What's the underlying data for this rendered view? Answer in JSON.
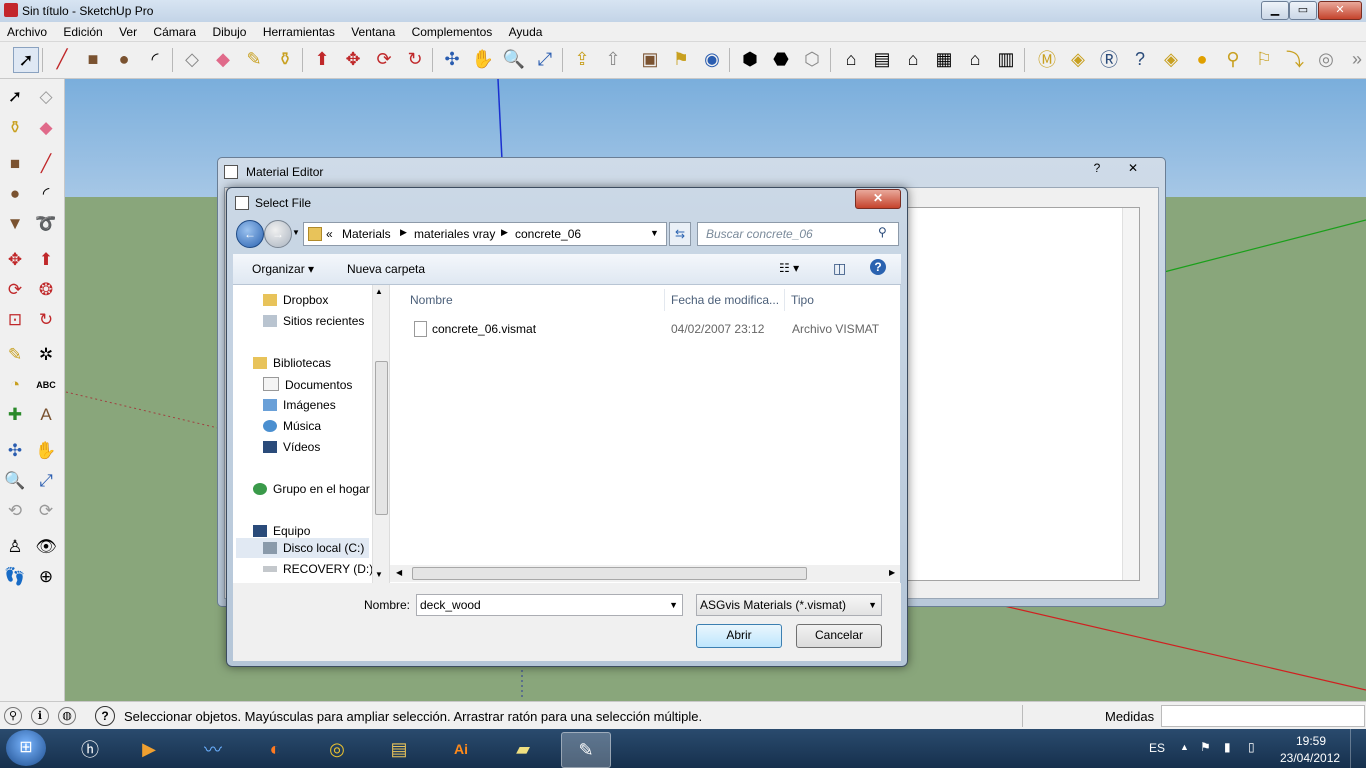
{
  "app": {
    "title": "Sin título - SketchUp Pro"
  },
  "menu": [
    "Archivo",
    "Edición",
    "Ver",
    "Cámara",
    "Dibujo",
    "Herramientas",
    "Ventana",
    "Complementos",
    "Ayuda"
  ],
  "material_editor": {
    "title": "Material Editor",
    "help": "?",
    "close": "✕"
  },
  "select_file": {
    "title": "Select File",
    "close": "✕",
    "breadcrumb": {
      "prefix": "«",
      "parts": [
        "Materials",
        "materiales vray",
        "concrete_06"
      ]
    },
    "search_placeholder": "Buscar concrete_06",
    "commands": {
      "organize": "Organizar",
      "new_folder": "Nueva carpeta"
    },
    "nav": {
      "favorites": [
        "Dropbox",
        "Sitios recientes"
      ],
      "libraries": "Bibliotecas",
      "library_items": [
        "Documentos",
        "Imágenes",
        "Música",
        "Vídeos"
      ],
      "homegroup": "Grupo en el hogar",
      "computer": "Equipo",
      "drives": [
        "Disco local (C:)",
        "RECOVERY (D:)"
      ]
    },
    "columns": {
      "name": "Nombre",
      "date": "Fecha de modifica...",
      "type": "Tipo"
    },
    "files": [
      {
        "name": "concrete_06.vismat",
        "date": "04/02/2007 23:12",
        "type": "Archivo VISMAT"
      }
    ],
    "filename_label": "Nombre:",
    "filename_value": "deck_wood",
    "filter": "ASGvis Materials (*.vismat)",
    "open_button": "Abrir",
    "cancel_button": "Cancelar"
  },
  "status": {
    "hint": "Seleccionar objetos. Mayúsculas para ampliar selección. Arrastrar ratón para una selección múltiple.",
    "measures_label": "Medidas"
  },
  "taskbar": {
    "lang": "ES",
    "time": "19:59",
    "date": "23/04/2012"
  },
  "colors": {
    "sky": "#8fb8e0",
    "ground": "#89a67b",
    "accent": "#3a6ea5"
  }
}
